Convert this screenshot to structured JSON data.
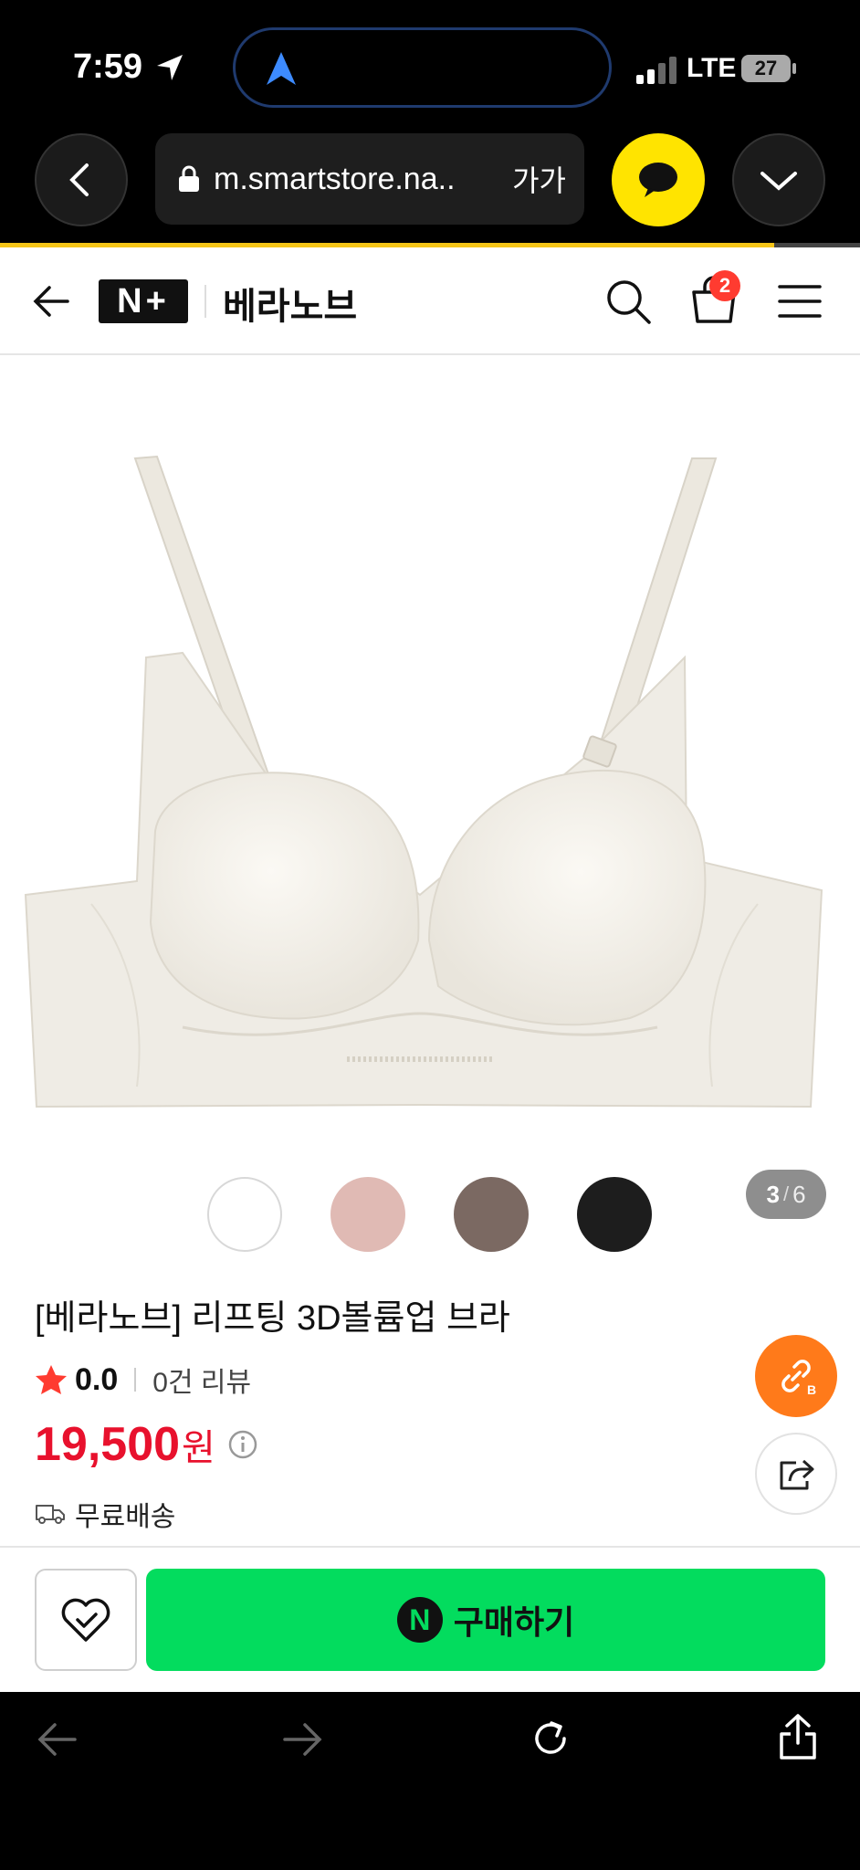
{
  "status": {
    "time": "7:59",
    "network": "LTE",
    "battery": "27"
  },
  "browser": {
    "url": "m.smartstore.na..",
    "text_size": "가가"
  },
  "header": {
    "logo": "N+",
    "store_name": "베라노브",
    "cart_count": "2"
  },
  "gallery": {
    "pager_current": "3",
    "pager_sep": "/",
    "pager_total": "6",
    "swatches": [
      {
        "name": "white",
        "color": "#ffffff"
      },
      {
        "name": "pink",
        "color": "#e0bab4"
      },
      {
        "name": "brown",
        "color": "#7b6962"
      },
      {
        "name": "black",
        "color": "#1d1d1d"
      }
    ]
  },
  "product": {
    "title": "[베라노브] 리프팅 3D볼륨업 브라",
    "rating": "0.0",
    "review_count": "0건 리뷰",
    "price": "19,500",
    "currency": "원",
    "shipping": "무료배송"
  },
  "bottom": {
    "buy_label": "구매하기"
  },
  "colors": {
    "accent_green": "#03dc5e",
    "price_red": "#e8112d",
    "kakao_yellow": "#ffe400",
    "fab_orange": "#ff7a1a"
  }
}
